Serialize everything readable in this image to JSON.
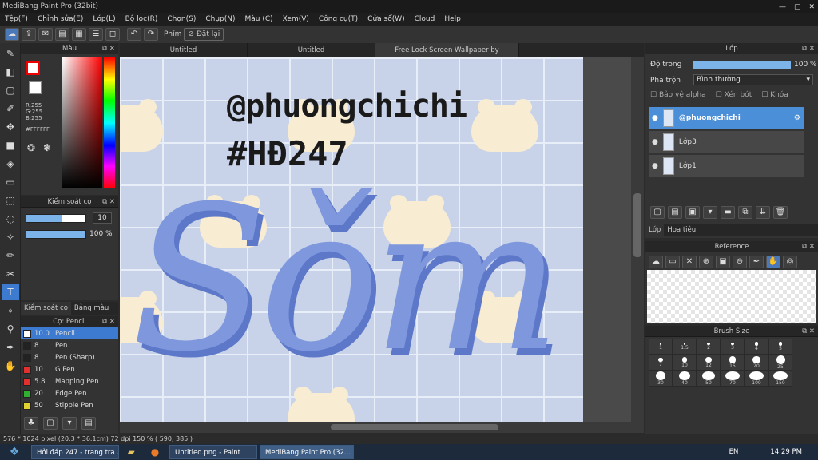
{
  "title": "MediBang Paint Pro (32bit)",
  "window_buttons": [
    "—",
    "▢",
    "✕"
  ],
  "menu": [
    "Tệp(F)",
    "Chỉnh sửa(E)",
    "Lớp(L)",
    "Bộ lọc(R)",
    "Chọn(S)",
    "Chụp(N)",
    "Màu (C)",
    "Xem(V)",
    "Công cụ(T)",
    "Cửa sổ(W)",
    "Cloud",
    "Help"
  ],
  "toolbar": {
    "phim_label": "Phím",
    "reset_label": "Đặt lại"
  },
  "color_panel": {
    "title": "Màu",
    "rgb": "R:255\nG:255\nB:255",
    "hex": "#FFFFFF"
  },
  "brush_control": {
    "title": "Kiểm soát cọ",
    "size": "10",
    "opacity": "100 %",
    "size_fill": 0.6,
    "opacity_fill": 1.0
  },
  "brush_tabs": [
    "Kiểm soát cọ",
    "Bảng màu"
  ],
  "brush_list": {
    "title": "Cọ: Pencil",
    "items": [
      {
        "size": "10.0",
        "name": "Pencil",
        "color": "#ffffff",
        "sel": true
      },
      {
        "size": "8",
        "name": "Pen",
        "color": "#222222"
      },
      {
        "size": "8",
        "name": "Pen (Sharp)",
        "color": "#222222"
      },
      {
        "size": "10",
        "name": "G Pen",
        "color": "#e03030"
      },
      {
        "size": "5.8",
        "name": "Mapping Pen",
        "color": "#e03030"
      },
      {
        "size": "20",
        "name": "Edge Pen",
        "color": "#30b030"
      },
      {
        "size": "50",
        "name": "Stipple Pen",
        "color": "#e0d030"
      }
    ]
  },
  "tabs": [
    "Untitled",
    "Untitled",
    "Free Lock Screen Wallpaper by Bymunbear.jpg"
  ],
  "canvas": {
    "line1": "@phuongchichi",
    "line2": "#HĐ247",
    "big": "Sǒm"
  },
  "status": "576 * 1024 pixel  (20.3 * 36.1cm)  72 dpi  150 %  ( 590, 385 )",
  "layer_panel": {
    "title": "Lớp",
    "opacity_label": "Độ trong",
    "opacity": "100 %",
    "blend_label": "Pha trộn",
    "blend": "Bình thường",
    "alpha_label": "Bảo vệ alpha",
    "clip_label": "Xén bớt",
    "lock_label": "Khóa",
    "layers": [
      {
        "name": "@phuongchichi",
        "sel": true
      },
      {
        "name": "Lớp3"
      },
      {
        "name": "Lớp1"
      }
    ]
  },
  "layer_tabs": [
    "Lớp",
    "Hoa tiêu"
  ],
  "reference": {
    "title": "Reference"
  },
  "brush_size": {
    "title": "Brush Size",
    "sizes": [
      "1",
      "1.5",
      "2",
      "3",
      "4",
      "5",
      "7",
      "10",
      "12",
      "15",
      "20",
      "25",
      "30",
      "40",
      "50",
      "70",
      "100",
      "150"
    ]
  },
  "taskbar": {
    "items": [
      "Hỏi đáp 247 - trang tra ...",
      "Untitled.png - Paint",
      "MediBang Paint Pro (32..."
    ],
    "lang": "EN",
    "time": "14:29 PM"
  }
}
